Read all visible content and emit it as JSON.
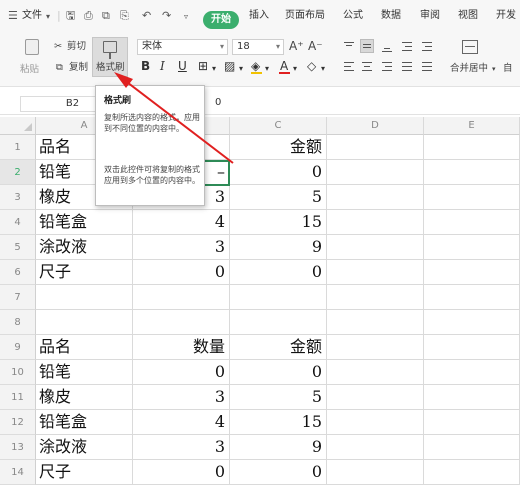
{
  "menubar": {
    "file_label": "文件",
    "tabs": [
      "开始",
      "插入",
      "页面布局",
      "公式",
      "数据",
      "审阅",
      "视图",
      "开发"
    ]
  },
  "ribbon": {
    "paste_label": "粘贴",
    "cut_label": "剪切",
    "copy_label": "复制",
    "format_painter_label": "格式刷",
    "font_name": "宋体",
    "font_size": "18",
    "merge_label": "合并居中",
    "auto_label": "自"
  },
  "formula_bar": {
    "cell_ref": "B2",
    "value": "0"
  },
  "tooltip": {
    "title": "格式刷",
    "line1": "复制所选内容的格式，应用到不同位置的内容中。",
    "line2": "双击此控件可将复制的格式应用到多个位置的内容中。"
  },
  "sheet": {
    "columns": [
      "A",
      "B",
      "C",
      "D",
      "E"
    ],
    "rows": [
      {
        "num": "1",
        "a": "品名",
        "b": "",
        "c": "金额"
      },
      {
        "num": "2",
        "a": "铅笔",
        "b": "–",
        "c": "0"
      },
      {
        "num": "3",
        "a": "橡皮",
        "b": "3",
        "c": "5"
      },
      {
        "num": "4",
        "a": "铅笔盒",
        "b": "4",
        "c": "15"
      },
      {
        "num": "5",
        "a": "涂改液",
        "b": "3",
        "c": "9"
      },
      {
        "num": "6",
        "a": "尺子",
        "b": "0",
        "c": "0"
      },
      {
        "num": "7",
        "a": "",
        "b": "",
        "c": ""
      },
      {
        "num": "8",
        "a": "",
        "b": "",
        "c": ""
      },
      {
        "num": "9",
        "a": "品名",
        "b": "数量",
        "c": "金额"
      },
      {
        "num": "10",
        "a": "铅笔",
        "b": "0",
        "c": "0"
      },
      {
        "num": "11",
        "a": "橡皮",
        "b": "3",
        "c": "5"
      },
      {
        "num": "12",
        "a": "铅笔盒",
        "b": "4",
        "c": "15"
      },
      {
        "num": "13",
        "a": "涂改液",
        "b": "3",
        "c": "9"
      },
      {
        "num": "14",
        "a": "尺子",
        "b": "0",
        "c": "0"
      }
    ]
  },
  "colors": {
    "accent_green": "#3bae6d",
    "annotation_red": "#e02020"
  }
}
